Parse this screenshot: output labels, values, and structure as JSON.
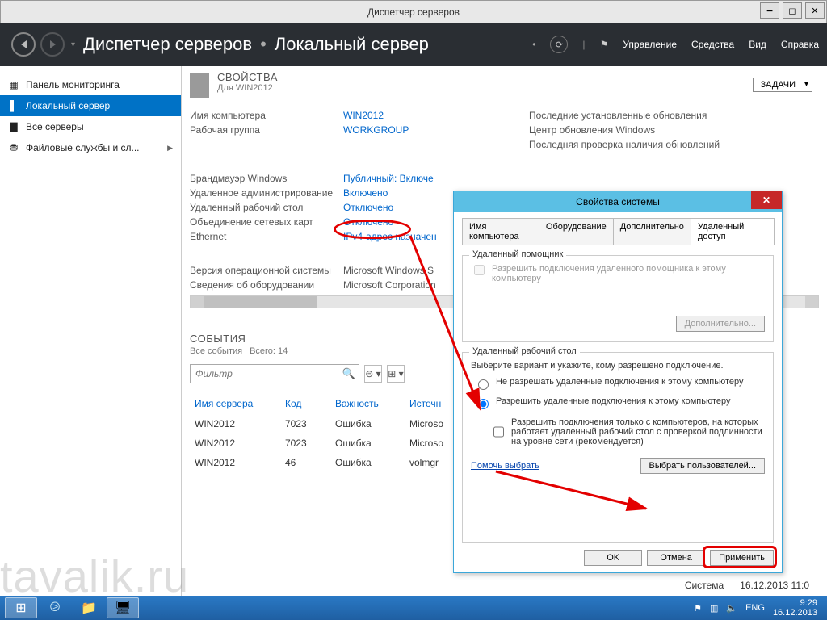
{
  "window": {
    "title": "Диспетчер серверов"
  },
  "header": {
    "breadcrumb_root": "Диспетчер серверов",
    "breadcrumb_leaf": "Локальный сервер",
    "menu": {
      "manage": "Управление",
      "tools": "Средства",
      "view": "Вид",
      "help": "Справка"
    }
  },
  "sidebar": {
    "items": [
      {
        "icon": "▦",
        "label": "Панель мониторинга"
      },
      {
        "icon": "▌",
        "label": "Локальный сервер"
      },
      {
        "icon": "▇",
        "label": "Все серверы"
      },
      {
        "icon": "⛃",
        "label": "Файловые службы и сл..."
      }
    ],
    "selected_index": 1
  },
  "properties": {
    "heading": "СВОЙСТВА",
    "subheading": "Для WIN2012",
    "tasks_button": "ЗАДАЧИ",
    "rows": [
      {
        "label": "Имя компьютера",
        "value": "WIN2012",
        "right": "Последние установленные обновления"
      },
      {
        "label": "Рабочая группа",
        "value": "WORKGROUP",
        "right": "Центр обновления Windows"
      },
      {
        "label": "",
        "value": "",
        "right": "Последняя проверка наличия обновлений"
      },
      {
        "label": "Брандмауэр Windows",
        "value": "Публичный: Включе"
      },
      {
        "label": "Удаленное администрирование",
        "value": "Включено"
      },
      {
        "label": "Удаленный рабочий стол",
        "value": "Отключено"
      },
      {
        "label": "Объединение сетевых карт",
        "value": "Отключено"
      },
      {
        "label": "Ethernet",
        "value": "IPv4-адрес назначен"
      },
      {
        "label": "Версия операционной системы",
        "value": "Microsoft Windows S"
      },
      {
        "label": "Сведения об оборудовании",
        "value": "Microsoft Corporation"
      }
    ]
  },
  "events": {
    "heading": "СОБЫТИЯ",
    "subheading": "Все события | Всего: 14",
    "filter_placeholder": "Фильтр",
    "columns": {
      "server": "Имя сервера",
      "code": "Код",
      "severity": "Важность",
      "source": "Источн"
    },
    "rows": [
      {
        "server": "WIN2012",
        "code": "7023",
        "severity": "Ошибка",
        "source": "Microso"
      },
      {
        "server": "WIN2012",
        "code": "7023",
        "severity": "Ошибка",
        "source": "Microso"
      },
      {
        "server": "WIN2012",
        "code": "46",
        "severity": "Ошибка",
        "source": "volmgr"
      }
    ],
    "extra_system": "Система",
    "extra_time": "16.12.2013 11:0"
  },
  "dialog": {
    "title": "Свойства системы",
    "tabs": {
      "name": "Имя компьютера",
      "hw": "Оборудование",
      "adv": "Дополнительно",
      "remote": "Удаленный доступ"
    },
    "group1": {
      "legend": "Удаленный помощник",
      "checkbox": "Разрешить подключения удаленного помощника к этому компьютеру",
      "advanced_btn": "Дополнительно..."
    },
    "group2": {
      "legend": "Удаленный рабочий стол",
      "prompt": "Выберите вариант и укажите, кому разрешено подключение.",
      "radio_deny": "Не разрешать удаленные подключения к этому компьютеру",
      "radio_allow": "Разрешить удаленные подключения к этому компьютеру",
      "nla": "Разрешить подключения только с компьютеров, на которых работает удаленный рабочий стол с проверкой подлинности на уровне сети (рекомендуется)",
      "help_link": "Помочь выбрать",
      "select_users_btn": "Выбрать пользователей..."
    },
    "buttons": {
      "ok": "OK",
      "cancel": "Отмена",
      "apply": "Применить"
    }
  },
  "taskbar": {
    "lang": "ENG",
    "time": "9:29",
    "date": "16.12.2013"
  },
  "watermark": "tavalik.ru"
}
